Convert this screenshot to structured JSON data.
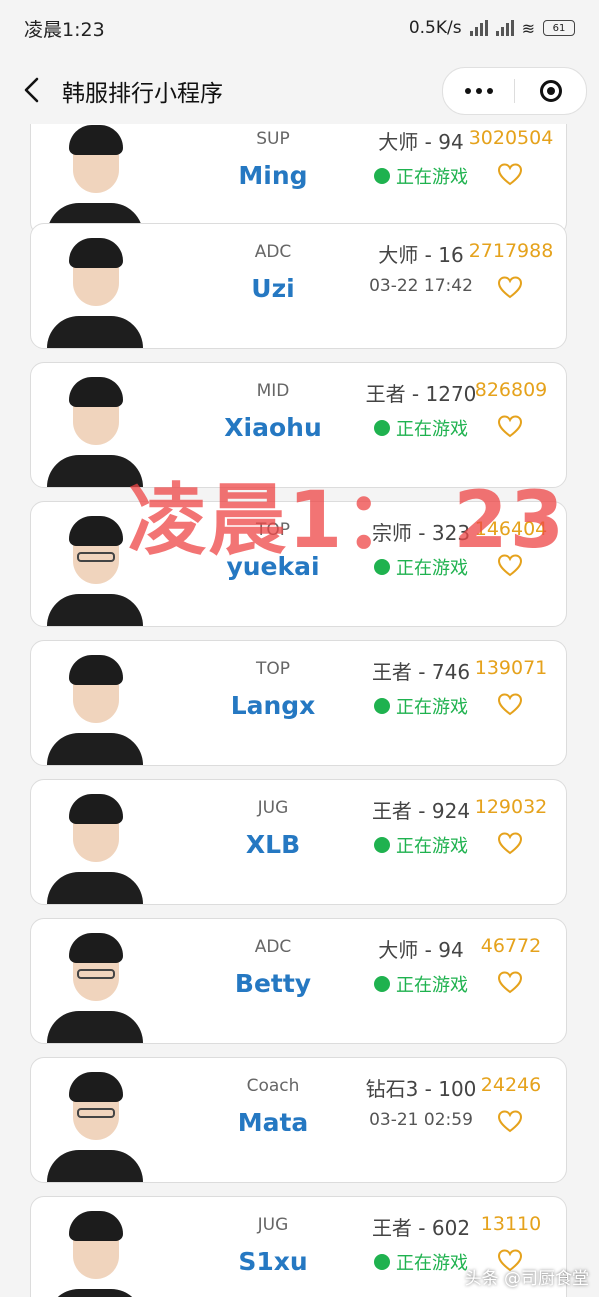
{
  "status_bar": {
    "time": "凌晨1:23",
    "net_speed": "0.5K/s",
    "battery": "61"
  },
  "nav": {
    "title": "韩服排行小程序"
  },
  "players": [
    {
      "role": "SUP",
      "name": "Ming",
      "rank": "大师 - 94",
      "status": "正在游戏",
      "online": true,
      "score": "3020504",
      "glasses": false
    },
    {
      "role": "ADC",
      "name": "Uzi",
      "rank": "大师 - 16",
      "status": "03-22 17:42",
      "online": false,
      "score": "2717988",
      "glasses": false
    },
    {
      "role": "MID",
      "name": "Xiaohu",
      "rank": "王者 - 1270",
      "status": "正在游戏",
      "online": true,
      "score": "826809",
      "glasses": false
    },
    {
      "role": "TOP",
      "name": "yuekai",
      "rank": "宗师 - 323",
      "status": "正在游戏",
      "online": true,
      "score": "146404",
      "glasses": true
    },
    {
      "role": "TOP",
      "name": "Langx",
      "rank": "王者 - 746",
      "status": "正在游戏",
      "online": true,
      "score": "139071",
      "glasses": false
    },
    {
      "role": "JUG",
      "name": "XLB",
      "rank": "王者 - 924",
      "status": "正在游戏",
      "online": true,
      "score": "129032",
      "glasses": false
    },
    {
      "role": "ADC",
      "name": "Betty",
      "rank": "大师 - 94",
      "status": "正在游戏",
      "online": true,
      "score": "46772",
      "glasses": true
    },
    {
      "role": "Coach",
      "name": "Mata",
      "rank": "钻石3 - 100",
      "status": "03-21 02:59",
      "online": false,
      "score": "24246",
      "glasses": true
    },
    {
      "role": "JUG",
      "name": "S1xu",
      "rank": "王者 - 602",
      "status": "正在游戏",
      "online": true,
      "score": "13110",
      "glasses": false
    }
  ],
  "overlay": {
    "watermark": "凌晨1： 23",
    "credit": "头条 @司厨食堂"
  },
  "colors": {
    "name": "#2578c2",
    "score": "#e5a21c",
    "online": "#1fb24f",
    "watermark": "#ee4646"
  }
}
